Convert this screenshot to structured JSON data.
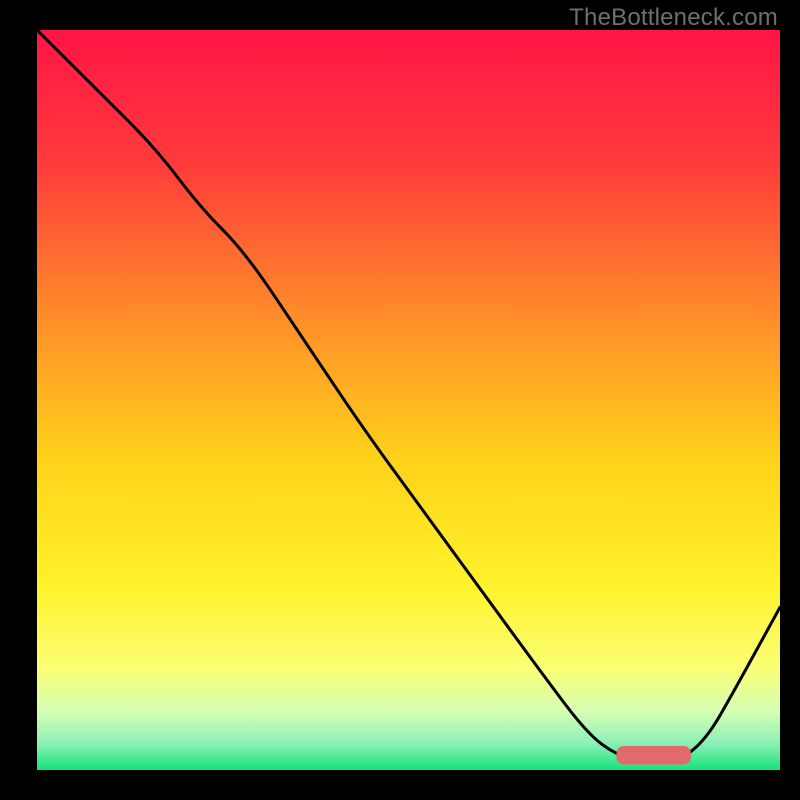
{
  "watermark": "TheBottleneck.com",
  "colors": {
    "bg": "#000000",
    "curve": "#000000",
    "marker": "#e26a6a",
    "gradient_stops": [
      {
        "offset": 0.0,
        "color": "#ff1545"
      },
      {
        "offset": 0.18,
        "color": "#ff3b3b"
      },
      {
        "offset": 0.38,
        "color": "#ff8a2a"
      },
      {
        "offset": 0.58,
        "color": "#ffd21a"
      },
      {
        "offset": 0.75,
        "color": "#fff22a"
      },
      {
        "offset": 0.86,
        "color": "#fbff72"
      },
      {
        "offset": 0.92,
        "color": "#d6ffb3"
      },
      {
        "offset": 0.965,
        "color": "#8af0b6"
      },
      {
        "offset": 1.0,
        "color": "#16e27a"
      }
    ]
  },
  "chart_data": {
    "type": "line",
    "title": "",
    "xlabel": "",
    "ylabel": "",
    "xlim": [
      0,
      100
    ],
    "ylim": [
      0,
      100
    ],
    "series": [
      {
        "name": "bottleneck-curve",
        "x": [
          0,
          8,
          16,
          22,
          28,
          36,
          44,
          52,
          60,
          68,
          74,
          78,
          82,
          86,
          90,
          94,
          100
        ],
        "y": [
          100,
          92,
          84,
          76,
          70,
          58,
          46,
          35,
          24,
          13,
          5,
          2,
          1,
          1,
          4,
          11,
          22
        ]
      }
    ],
    "marker": {
      "name": "optimal-range",
      "x_start": 78,
      "x_end": 88,
      "y": 2,
      "thickness": 2.5
    },
    "notes": "Axes unlabeled in source; 0–100 normalized. y is % bottleneck (higher = worse, red). Curve starts top-left, inflects near x≈22, descends to near-zero at x≈80–88, then rises toward the right edge. Background is a vertical red→green gradient. A short rounded pink bar marks the optimal region near the trough."
  }
}
